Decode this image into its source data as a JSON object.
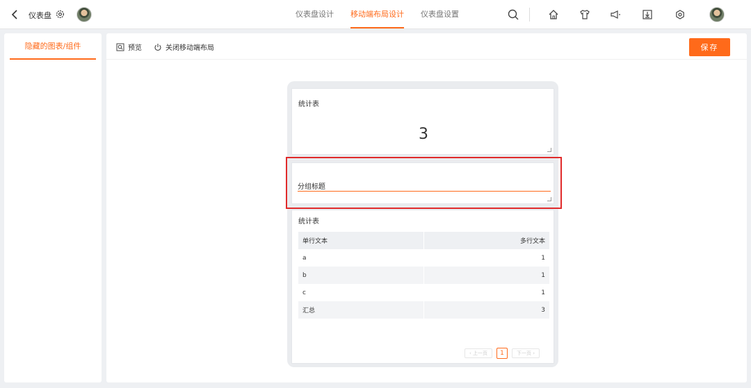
{
  "header": {
    "app_title": "仪表盘",
    "tabs": [
      {
        "label": "仪表盘设计",
        "active": false
      },
      {
        "label": "移动端布局设计",
        "active": true
      },
      {
        "label": "仪表盘设置",
        "active": false
      }
    ],
    "icons": [
      "back-icon",
      "gear-icon",
      "search-icon",
      "home-icon",
      "shirt-icon",
      "megaphone-icon",
      "download-icon",
      "settings-hex-icon"
    ]
  },
  "sidebar": {
    "tab_label": "隐藏的图表/组件"
  },
  "toolbar": {
    "preview_label": "预览",
    "close_mobile_label": "关闭移动端布局",
    "save_label": "保存"
  },
  "canvas": {
    "card1": {
      "title": "统计表",
      "value": "3"
    },
    "group": {
      "placeholder": "分组标题"
    },
    "card2": {
      "title": "统计表",
      "columns": [
        "单行文本",
        "多行文本"
      ],
      "rows": [
        {
          "a": "a",
          "b": "1"
        },
        {
          "a": "b",
          "b": "1"
        },
        {
          "a": "c",
          "b": "1"
        },
        {
          "a": "汇总",
          "b": "3"
        }
      ],
      "pager": {
        "prev": "‹ 上一页",
        "current": "1",
        "next": "下一页 ›"
      }
    }
  },
  "colors": {
    "accent": "#ff6a1a",
    "highlight": "#e02a2a",
    "background": "#eef0f3"
  }
}
